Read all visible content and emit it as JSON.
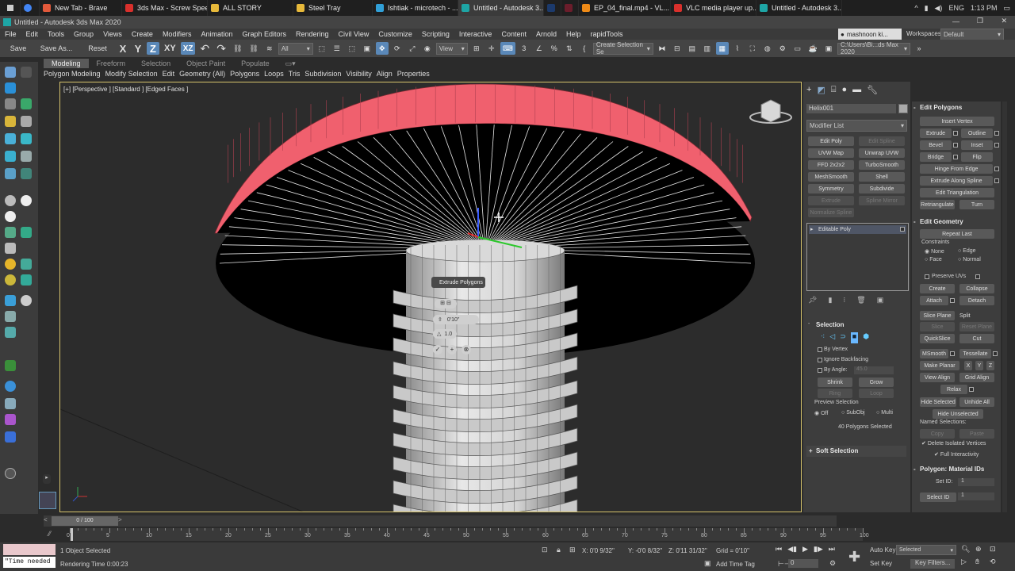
{
  "taskbar": {
    "tabs": [
      {
        "label": "New Tab - Brave",
        "color": "#e2593b"
      },
      {
        "label": "3ds Max - Screw Spee...",
        "color": "#d9302c"
      },
      {
        "label": "ALL STORY",
        "color": "#e7b93a"
      },
      {
        "label": "Steel Tray",
        "color": "#e7b93a"
      },
      {
        "label": "Ishtiak - microtech - ...",
        "color": "#31a0d8"
      },
      {
        "label": "Untitled - Autodesk 3...",
        "color": "#1ea5a5"
      },
      {
        "label": "Ps",
        "color": "#1c3a6c"
      },
      {
        "label": "Pl",
        "color": "#6b1d2b"
      },
      {
        "label": "EP_04_final.mp4 - VL...",
        "color": "#ee8a17"
      },
      {
        "label": "VLC media player up...",
        "color": "#d9302c"
      },
      {
        "label": "Untitled - Autodesk 3...",
        "color": "#1ea5a5"
      }
    ],
    "lang": "ENG",
    "time": "1:13 PM"
  },
  "title": "Untitled - Autodesk 3ds Max 2020",
  "menu": [
    "File",
    "Edit",
    "Tools",
    "Group",
    "Views",
    "Create",
    "Modifiers",
    "Animation",
    "Graph Editors",
    "Rendering",
    "Civil View",
    "Customize",
    "Scripting",
    "Interactive",
    "Content",
    "Arnold",
    "Help",
    "rapidTools"
  ],
  "user": "mashnoon ki...",
  "workspaces_label": "Workspaces:",
  "workspace": "Default",
  "toolbar": {
    "save": "Save",
    "save_as": "Save As...",
    "reset": "Reset",
    "x": "X",
    "y": "Y",
    "z": "Z",
    "xy": "XY",
    "xz": "XZ",
    "filter": "All",
    "view": "View",
    "selset": "Create Selection Se",
    "path": "C:\\Users\\Bi...ds Max 2020"
  },
  "ribbon_tabs": [
    "Modeling",
    "Freeform",
    "Selection",
    "Object Paint",
    "Populate"
  ],
  "ribbon_items": [
    "Polygon Modeling",
    "Modify Selection",
    "Edit",
    "Geometry (All)",
    "Polygons",
    "Loops",
    "Tris",
    "Subdivision",
    "Visibility",
    "Align",
    "Properties"
  ],
  "viewport": {
    "label": "[+] [Perspective ] [Standard ] [Edged Faces ]"
  },
  "caddy": {
    "title": "Extrude Polygons",
    "height": "0'10\"",
    "outline": "1.0"
  },
  "command_panel": {
    "object_name": "Helix001",
    "modifier_list": "Modifier List",
    "modifier_buttons": [
      [
        "Edit Poly",
        "Edit Spline"
      ],
      [
        "UVW Map",
        "Unwrap UVW"
      ],
      [
        "FFD 2x2x2",
        "TurboSmooth"
      ],
      [
        "MeshSmooth",
        "Shell"
      ],
      [
        "Symmetry",
        "Subdivide"
      ],
      [
        "Extrude",
        "Spline Mirror"
      ],
      [
        "Normalize Spline",
        ""
      ]
    ],
    "stack_item": "Editable Poly",
    "selection_header": "Selection",
    "by_vertex": "By Vertex",
    "ignore_backfacing": "Ignore Backfacing",
    "by_angle": "By Angle:",
    "angle": "45.0",
    "shrink": "Shrink",
    "grow": "Grow",
    "ring": "Ring",
    "loop": "Loop",
    "preview_selection": "Preview Selection",
    "preview_off": "Off",
    "preview_subobj": "SubObj",
    "preview_multi": "Multi",
    "selected_count": "40 Polygons Selected",
    "soft_selection": "Soft Selection"
  },
  "rollout": {
    "edit_polygons": "Edit Polygons",
    "insert_vertex": "Insert Vertex",
    "extrude": "Extrude",
    "outline": "Outline",
    "bevel": "Bevel",
    "inset": "Inset",
    "bridge": "Bridge",
    "flip": "Flip",
    "hinge": "Hinge From Edge",
    "extrude_spline": "Extrude Along Spline",
    "edit_triangulation": "Edit Triangulation",
    "retriangulate": "Retriangulate",
    "turn": "Turn",
    "edit_geometry": "Edit Geometry",
    "repeat_last": "Repeat Last",
    "constraints": "Constraints",
    "c_none": "None",
    "c_edge": "Edge",
    "c_face": "Face",
    "c_normal": "Normal",
    "preserve_uvs": "Preserve UVs",
    "create": "Create",
    "collapse": "Collapse",
    "attach": "Attach",
    "detach": "Detach",
    "slice_plane": "Slice Plane",
    "split": "Split",
    "slice": "Slice",
    "reset_plane": "Reset Plane",
    "quickslice": "QuickSlice",
    "cut": "Cut",
    "msmooth": "MSmooth",
    "tessellate": "Tessellate",
    "make_planar": "Make Planar",
    "px": "X",
    "py": "Y",
    "pz": "Z",
    "view_align": "View Align",
    "grid_align": "Grid Align",
    "relax": "Relax",
    "hide_selected": "Hide Selected",
    "unhide_all": "Unhide All",
    "hide_unselected": "Hide Unselected",
    "named_selections": "Named Selections:",
    "copy": "Copy",
    "paste": "Paste",
    "delete_isolated": "Delete Isolated Vertices",
    "full_interactivity": "Full Interactivity",
    "material_ids": "Polygon: Material IDs",
    "set_id": "Set ID:",
    "set_id_val": "1",
    "select_id": "Select ID",
    "select_id_val": "1"
  },
  "timeline": {
    "slider": "0 / 100"
  },
  "ruler_ticks": [
    "0",
    "5",
    "10",
    "15",
    "20",
    "25",
    "30",
    "35",
    "40",
    "45",
    "50",
    "55",
    "60",
    "65",
    "70",
    "75",
    "80",
    "85",
    "90",
    "95",
    "100"
  ],
  "status": {
    "time_needed": "\"Time needed",
    "objects_selected": "1 Object Selected",
    "rendering_time": "Rendering Time  0:00:23",
    "x": "X: 0'0 9/32\"",
    "y": "Y: -0'0 8/32\"",
    "z": "Z: 0'11 31/32\"",
    "grid": "Grid = 0'10\"",
    "add_time_tag": "Add Time Tag",
    "auto_key": "Auto Key",
    "selected": "Selected",
    "set_key": "Set Key",
    "key_filters": "Key Filters...",
    "frame": "0"
  }
}
